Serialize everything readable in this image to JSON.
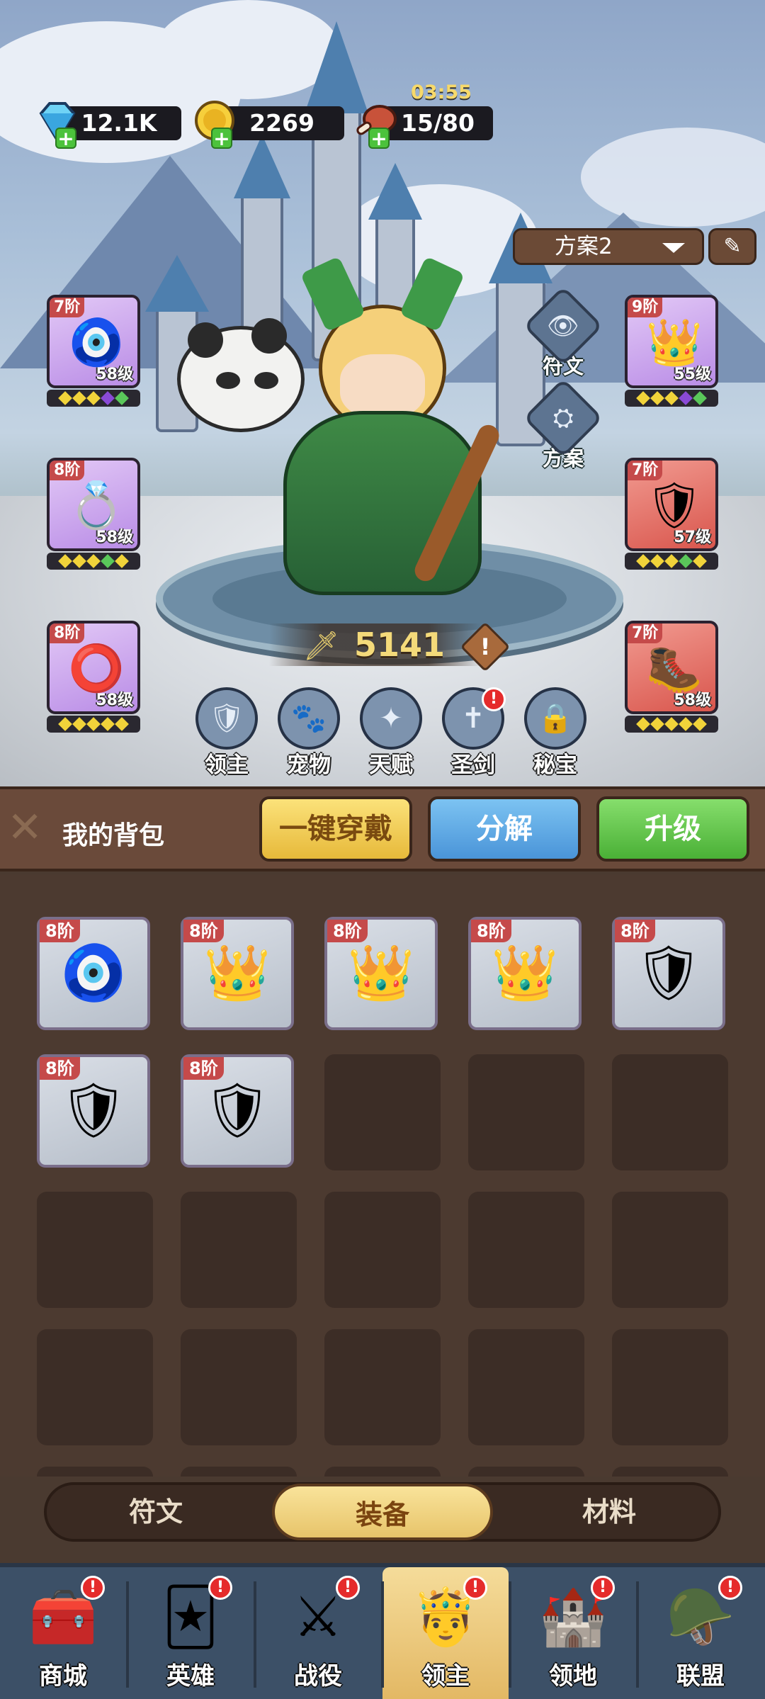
{
  "resources": {
    "diamonds": "12.1K",
    "gold": "2269",
    "stamina": "15/80",
    "timer": "03:55"
  },
  "scheme": {
    "label": "方案2"
  },
  "side_buttons": {
    "rune": "符文",
    "scheme": "方案"
  },
  "equipment_left": [
    {
      "tier": "7阶",
      "level": "58级",
      "icon": "amulet-icon",
      "gem": "🧿",
      "bg": "purple"
    },
    {
      "tier": "8阶",
      "level": "58级",
      "icon": "ring-icon",
      "gem": "💍",
      "bg": "purple"
    },
    {
      "tier": "8阶",
      "level": "58级",
      "icon": "bracelet-icon",
      "gem": "⭕",
      "bg": "purple"
    }
  ],
  "equipment_right": [
    {
      "tier": "9阶",
      "level": "55级",
      "icon": "helmet-icon",
      "gem": "👑",
      "bg": "purple"
    },
    {
      "tier": "7阶",
      "level": "57级",
      "icon": "armor-icon",
      "gem": "🛡",
      "bg": "red"
    },
    {
      "tier": "7阶",
      "level": "58级",
      "icon": "boots-icon",
      "gem": "🥾",
      "bg": "red"
    }
  ],
  "power": "5141",
  "features": [
    {
      "label": "领主",
      "icon": "shield-crest-icon",
      "glyph": "🛡"
    },
    {
      "label": "宠物",
      "icon": "paw-icon",
      "glyph": "🐾"
    },
    {
      "label": "天赋",
      "icon": "talent-node-icon",
      "glyph": "✦"
    },
    {
      "label": "圣剑",
      "icon": "holy-sword-icon",
      "glyph": "✝"
    },
    {
      "label": "秘宝",
      "icon": "lock-icon",
      "glyph": "🔒"
    }
  ],
  "bag": {
    "title": "我的背包",
    "equip_all": "一键穿戴",
    "dismantle": "分解",
    "upgrade": "升级",
    "items": [
      {
        "tier": "8阶",
        "icon": "amulet-icon",
        "gem": "🧿"
      },
      {
        "tier": "8阶",
        "icon": "helmet-icon",
        "gem": "👑"
      },
      {
        "tier": "8阶",
        "icon": "helmet-icon",
        "gem": "👑"
      },
      {
        "tier": "8阶",
        "icon": "helmet-icon",
        "gem": "👑"
      },
      {
        "tier": "8阶",
        "icon": "armor-icon",
        "gem": "🛡"
      },
      {
        "tier": "8阶",
        "icon": "armor-icon",
        "gem": "🛡"
      },
      {
        "tier": "8阶",
        "icon": "armor-icon",
        "gem": "🛡"
      }
    ]
  },
  "tabs": {
    "rune": "符文",
    "equipment": "装备",
    "material": "材料"
  },
  "nav": [
    {
      "label": "商城",
      "icon": "chest-icon",
      "glyph": "🧰"
    },
    {
      "label": "英雄",
      "icon": "hero-cards-icon",
      "glyph": "🃏"
    },
    {
      "label": "战役",
      "icon": "crossed-swords-icon",
      "glyph": "⚔"
    },
    {
      "label": "领主",
      "icon": "lord-crown-icon",
      "glyph": "🤴"
    },
    {
      "label": "领地",
      "icon": "castle-icon",
      "glyph": "🏰"
    },
    {
      "label": "联盟",
      "icon": "knight-icon",
      "glyph": "🪖"
    }
  ]
}
